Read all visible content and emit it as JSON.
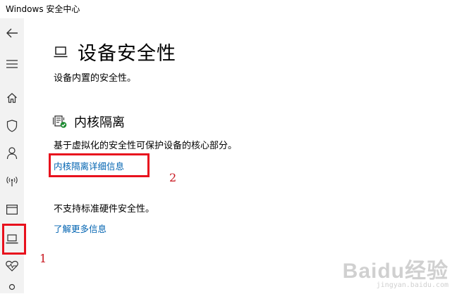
{
  "window": {
    "title": "Windows 安全中心"
  },
  "sidebar": {
    "items": [
      {
        "icon": "back-arrow-icon"
      },
      {
        "icon": "hamburger-menu-icon"
      },
      {
        "icon": "home-icon"
      },
      {
        "icon": "shield-icon"
      },
      {
        "icon": "account-icon"
      },
      {
        "icon": "network-icon"
      },
      {
        "icon": "app-browser-icon"
      },
      {
        "icon": "device-security-icon",
        "selected": true
      },
      {
        "icon": "health-icon"
      }
    ]
  },
  "page": {
    "title": "设备安全性",
    "description": "设备内置的安全性。"
  },
  "core_isolation": {
    "title": "内核隔离",
    "description": "基于虚拟化的安全性可保护设备的核心部分。",
    "details_link": "内核隔离详细信息"
  },
  "hardware": {
    "status": "不支持标准硬件安全性。",
    "learn_more_link": "了解更多信息"
  },
  "annotations": {
    "label_1": "1",
    "label_2": "2",
    "color": "#e8111d"
  },
  "watermark": {
    "logo": "Baidu经验",
    "sub": "jingyan.baidu.com"
  }
}
